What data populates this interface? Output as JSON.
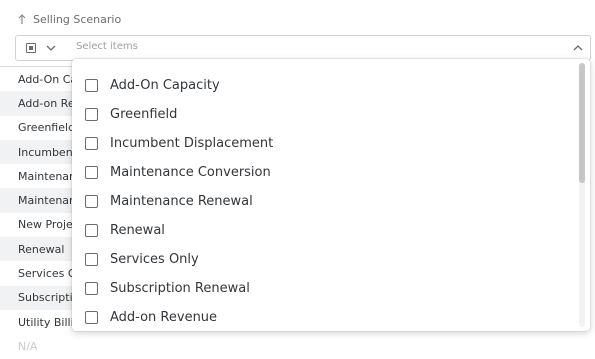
{
  "header": {
    "title": "Selling Scenario"
  },
  "select": {
    "placeholder": "Select items"
  },
  "background_list": [
    "Add-On Ca",
    "Add-on Rev",
    "Greenfield",
    "Incumbent",
    "Maintenan",
    "Maintenan",
    "New Projec",
    "Renewal",
    "Services On",
    "Subscriptio",
    "Utility Billin",
    "N/A"
  ],
  "dropdown": {
    "items": [
      "Add-On Capacity",
      "Greenfield",
      "Incumbent Displacement",
      "Maintenance Conversion",
      "Maintenance Renewal",
      "Renewal",
      "Services Only",
      "Subscription Renewal",
      "Add-on Revenue"
    ]
  }
}
